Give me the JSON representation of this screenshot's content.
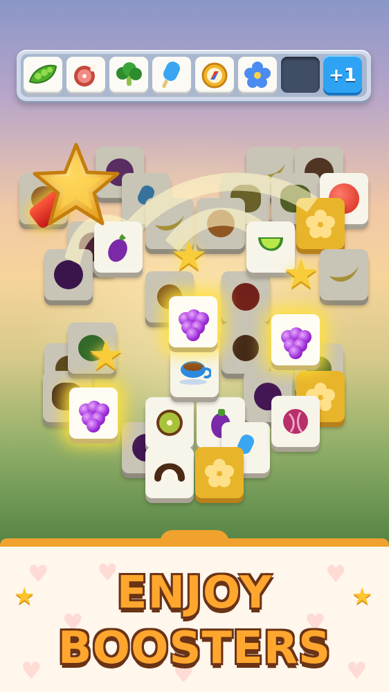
{
  "slot_bar": {
    "slots": [
      {
        "icon": "peas-icon"
      },
      {
        "icon": "ham-icon"
      },
      {
        "icon": "broccoli-icon"
      },
      {
        "icon": "popsicle-icon"
      },
      {
        "icon": "compass-icon"
      },
      {
        "icon": "blue-flower-icon"
      },
      {
        "icon": "empty"
      }
    ],
    "plus_label": "+1"
  },
  "board": {
    "highlighted_icon": "grape-icon",
    "booster": "magic-wand-icon"
  },
  "banner": {
    "line1": "ENJOY",
    "line2": "BOOSTERS"
  },
  "colors": {
    "accent": "#ffa62e",
    "outline": "#6a3316",
    "plus_button": "#2ea3f4"
  }
}
